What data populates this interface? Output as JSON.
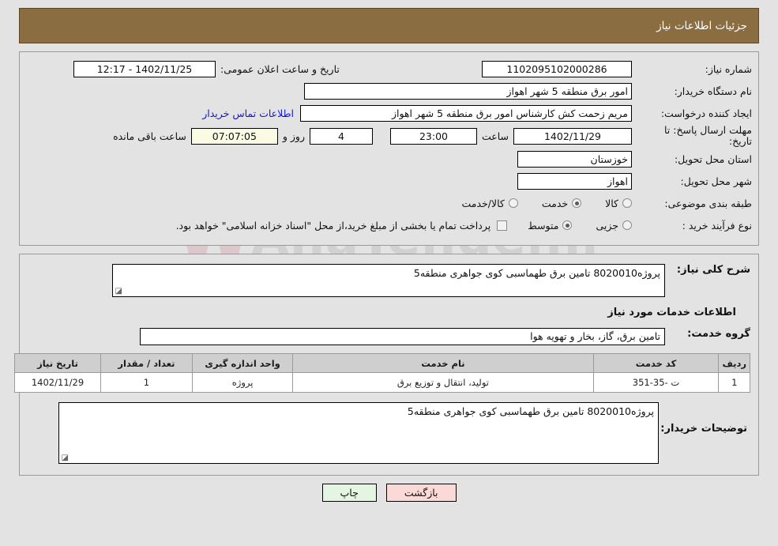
{
  "header": {
    "title": "جزئیات اطلاعات نیاز"
  },
  "watermark": {
    "text": "AnaTender.ir",
    "logo": "W"
  },
  "top": {
    "need_number_label": "شماره نیاز:",
    "need_number_value": "1102095102000286",
    "buyer_org_label": "نام دستگاه خریدار:",
    "buyer_org_value": "امور برق منطقه 5 شهر اهواز",
    "creator_label": "ایجاد کننده درخواست:",
    "creator_value": "مریم زحمت کش کارشناس امور برق منطقه 5 شهر اهواز",
    "contact_link": "اطلاعات تماس خریدار",
    "deadline_label": "مهلت ارسال پاسخ: تا تاریخ:",
    "deadline_date": "1402/11/29",
    "deadline_hour_label": "ساعت",
    "deadline_hour_value": "23:00",
    "days_value": "4",
    "days_label": "روز و",
    "countdown_value": "07:07:05",
    "countdown_label": "ساعت باقی مانده",
    "public_announce_label": "تاریخ و ساعت اعلان عمومی:",
    "public_announce_value": "1402/11/25 - 12:17",
    "province_label": "استان محل تحویل:",
    "province_value": "خوزستان",
    "city_label": "شهر محل تحویل:",
    "city_value": "اهواز",
    "category_label": "طبقه بندی موضوعی:",
    "category_options": [
      {
        "label": "کالا",
        "selected": false
      },
      {
        "label": "خدمت",
        "selected": true
      },
      {
        "label": "کالا/خدمت",
        "selected": false
      }
    ],
    "process_label": "نوع فرآیند خرید :",
    "process_options": [
      {
        "label": "جزیی",
        "selected": false
      },
      {
        "label": "متوسط",
        "selected": true
      }
    ],
    "treasury_checkbox_checked": false,
    "treasury_note": "پرداخت تمام یا بخشی از مبلغ خرید،از محل \"اسناد خزانه اسلامی\" خواهد بود."
  },
  "middle": {
    "general_desc_label": "شرح کلی نیاز:",
    "general_desc_value": "پروژه8020010 تامین برق طهماسبی کوی جواهری منطقه5",
    "services_section_title": "اطلاعات خدمات مورد نیاز",
    "service_group_label": "گروه خدمت:",
    "service_group_value": "تامین برق، گاز، بخار و تهویه هوا"
  },
  "table": {
    "columns": [
      "ردیف",
      "کد خدمت",
      "نام خدمت",
      "واحد اندازه گیری",
      "تعداد / مقدار",
      "تاریخ نیاز"
    ],
    "rows": [
      {
        "radif": "1",
        "code": "ت -35-351",
        "name": "تولید، انتقال و توزیع برق",
        "unit": "پروژه",
        "qty": "1",
        "date": "1402/11/29"
      }
    ]
  },
  "notes": {
    "label": "توضیحات خریدار:",
    "value": "پروژه8020010 تامین برق طهماسبی کوی جواهری منطقه5"
  },
  "footer": {
    "print_label": "چاپ",
    "back_label": "بازگشت"
  },
  "colors": {
    "header_bg": "#8b6d42",
    "page_bg": "#e3e3e3",
    "link": "#1414d2",
    "table_header_bg": "#cfcfcf",
    "print_btn_bg": "#e4f6e2",
    "back_btn_bg": "#fbd9d9",
    "countdown_bg": "#fbfbe4"
  }
}
